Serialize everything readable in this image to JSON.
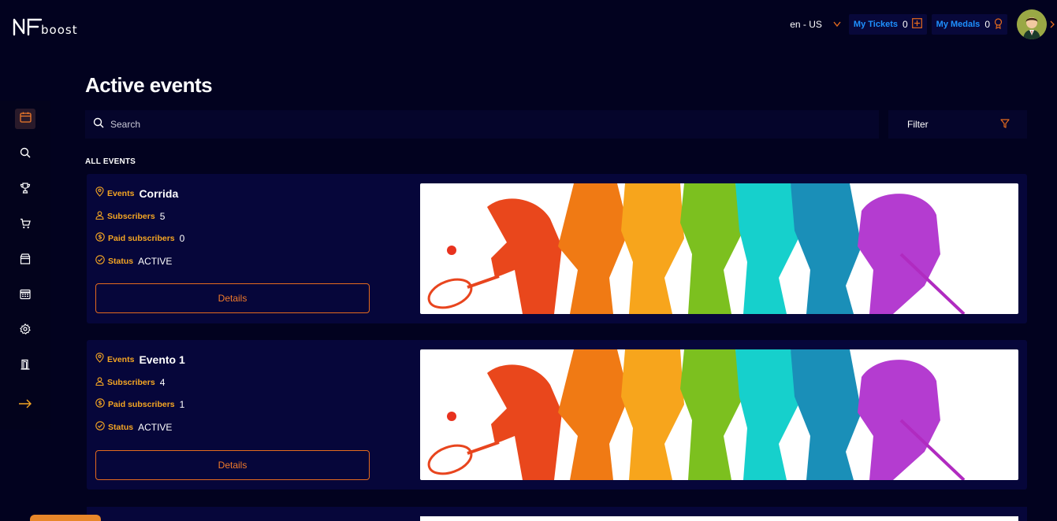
{
  "brand": {
    "logo_mark": "NF",
    "logo_word": "boost"
  },
  "header": {
    "language": "en - US",
    "tickets": {
      "label": "My Tickets",
      "count": "0"
    },
    "medals": {
      "label": "My Medals",
      "count": "0"
    }
  },
  "sidebar": {
    "items": [
      {
        "icon": "calendar-icon",
        "active": true
      },
      {
        "icon": "search-icon"
      },
      {
        "icon": "trophy-icon"
      },
      {
        "icon": "cart-icon"
      },
      {
        "icon": "store-icon"
      },
      {
        "icon": "table-icon"
      },
      {
        "icon": "gear-icon"
      },
      {
        "icon": "door-icon"
      },
      {
        "icon": "arrow-right-icon"
      }
    ]
  },
  "page": {
    "title": "Active events",
    "search_placeholder": "Search",
    "filter_label": "Filter",
    "section_label": "ALL EVENTS"
  },
  "labels": {
    "events": "Events",
    "subscribers": "Subscribers",
    "paid": "Paid subscribers",
    "status": "Status",
    "details": "Details"
  },
  "events": [
    {
      "name": "Corrida",
      "subscribers": "5",
      "paid": "0",
      "status": "ACTIVE"
    },
    {
      "name": "Evento 1",
      "subscribers": "4",
      "paid": "1",
      "status": "ACTIVE"
    }
  ],
  "colors": {
    "accent": "#f5a623",
    "orange": "#e46a1e",
    "blue": "#1e90ff",
    "bg": "#02021f",
    "card": "#06063a"
  }
}
